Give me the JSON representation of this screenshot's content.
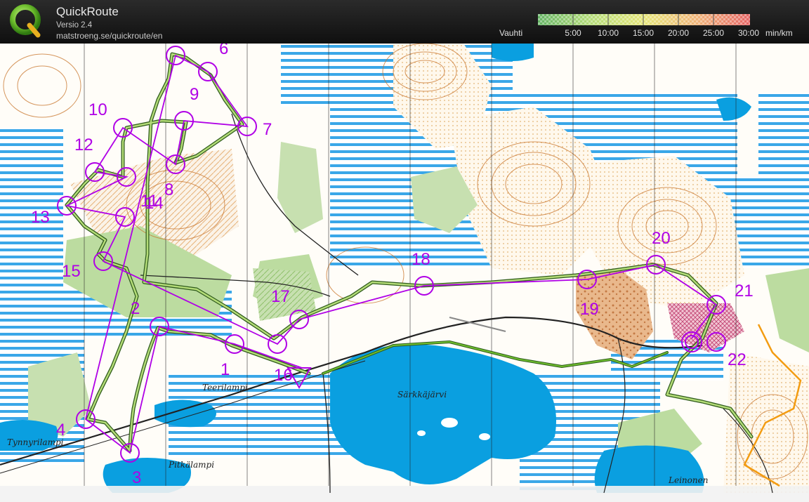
{
  "app": {
    "title": "QuickRoute",
    "version": "Versio 2.4",
    "url": "matstroeng.se/quickroute/en"
  },
  "pace_scale": {
    "label": "Vauhti",
    "ticks": [
      "5:00",
      "10:00",
      "15:00",
      "20:00",
      "25:00",
      "30:00"
    ],
    "unit": "min/km",
    "gradient_colors": [
      "#64b464",
      "#b4dc78",
      "#e6e678",
      "#f0b478",
      "#e66464"
    ]
  },
  "map": {
    "controls": [
      {
        "label": "1"
      },
      {
        "label": "2"
      },
      {
        "label": "3"
      },
      {
        "label": "4"
      },
      {
        "label": "6"
      },
      {
        "label": "7"
      },
      {
        "label": "8"
      },
      {
        "label": "9"
      },
      {
        "label": "10"
      },
      {
        "label": "11"
      },
      {
        "label": "12"
      },
      {
        "label": "13"
      },
      {
        "label": "14"
      },
      {
        "label": "15"
      },
      {
        "label": "16"
      },
      {
        "label": "17"
      },
      {
        "label": "18"
      },
      {
        "label": "19"
      },
      {
        "label": "20"
      },
      {
        "label": "21"
      },
      {
        "label": "22"
      }
    ],
    "place_names": [
      {
        "label": "Teerilampi"
      },
      {
        "label": "Särkkäjärvi"
      },
      {
        "label": "Tynnyrilampi"
      },
      {
        "label": "Pitkälampi"
      },
      {
        "label": "Leinonen"
      }
    ],
    "colors": {
      "course": "#b000e6",
      "route": "#4f8a2a",
      "water": "#0a9fe0",
      "marsh": "#3aa7e8",
      "green": "#a9d08e",
      "contour": "#c8742a"
    }
  }
}
